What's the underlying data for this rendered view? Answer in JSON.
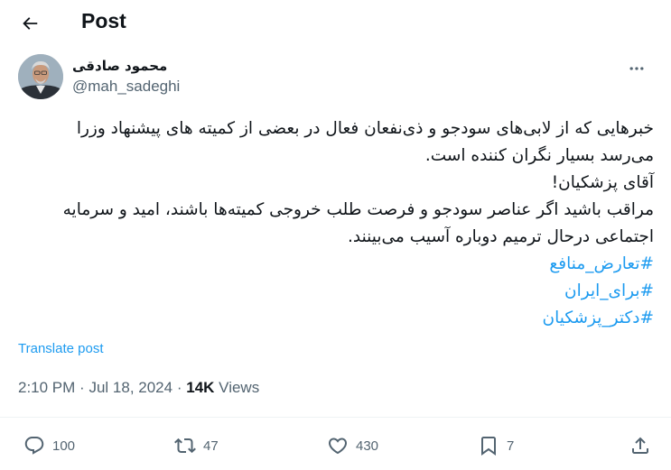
{
  "header": {
    "title": "Post",
    "back_icon": "arrow-left-icon"
  },
  "author": {
    "display_name": "محمود صادقی",
    "handle": "@mah_sadeghi"
  },
  "tweet": {
    "lines": [
      "خبرهایی که از لابی‌های سودجو و ذی‌نفعان فعال در بعضی از کمیته های پیشنهاد وزرا",
      "می‌رسد بسیار نگران کننده است.",
      "آقای پزشکیان!",
      "مراقب باشید اگر عناصر سودجو و فرصت طلب خروجی کمیته‌ها باشند، امید و سرمایه",
      "اجتماعی درحال ترمیم دوباره آسیب می‌بینند."
    ],
    "hashtags": [
      "#تعارض_منافع",
      "#برای_ایران",
      "#دکتر_پزشکیان"
    ]
  },
  "translate_label": "Translate post",
  "meta": {
    "time": "2:10 PM",
    "separator": "·",
    "date": "Jul 18, 2024",
    "views_count": "14K",
    "views_label": "Views"
  },
  "actions": {
    "replies": "100",
    "reposts": "47",
    "likes": "430",
    "bookmarks": "7"
  },
  "colors": {
    "accent": "#1d9bf0",
    "text": "#0f1419",
    "secondary": "#536471",
    "divider": "#eff3f4"
  }
}
